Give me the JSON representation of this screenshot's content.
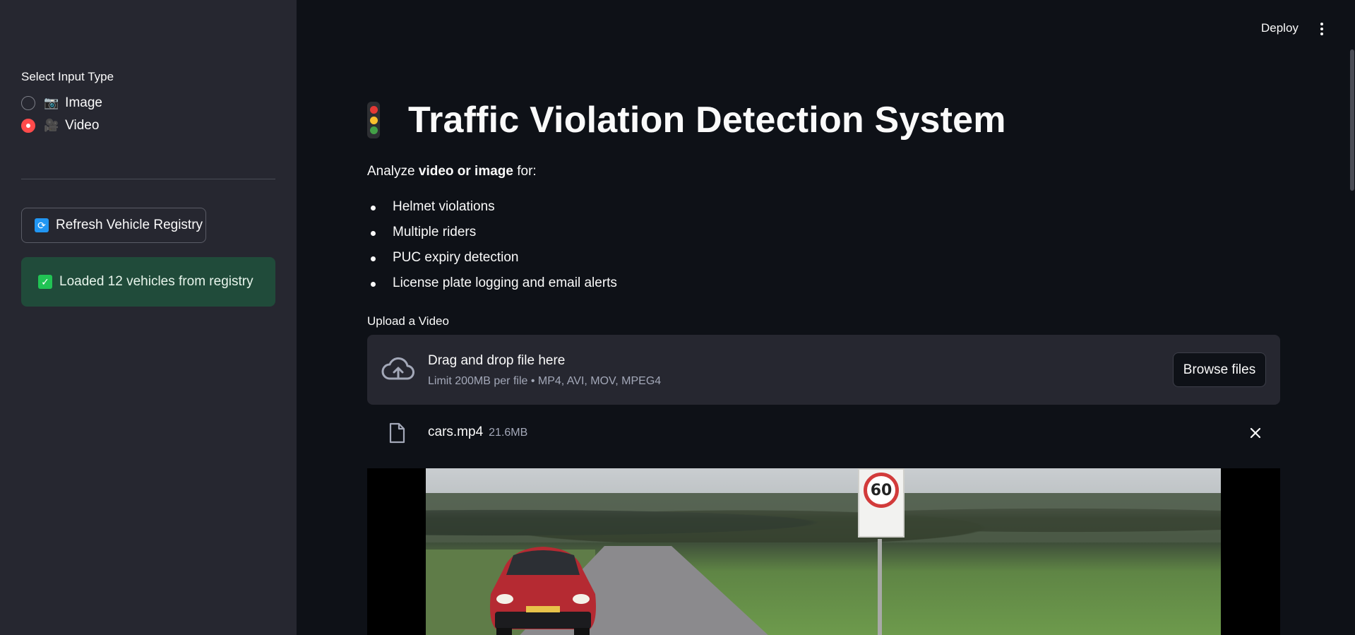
{
  "sidebar": {
    "input_type_label": "Select Input Type",
    "radio_options": [
      {
        "emoji": "📷",
        "label": "Image",
        "checked": false
      },
      {
        "emoji": "🎥",
        "label": "Video",
        "checked": true
      }
    ],
    "refresh_button_label": "Refresh Vehicle Registry",
    "success_message": "Loaded 12 vehicles from registry"
  },
  "header": {
    "deploy_label": "Deploy"
  },
  "main": {
    "title": "Traffic Violation Detection System",
    "intro_prefix": "Analyze ",
    "intro_bold": "video or image",
    "intro_suffix": " for:",
    "features": [
      "Helmet violations",
      "Multiple riders",
      "PUC expiry detection",
      "License plate logging and email alerts"
    ],
    "upload_label": "Upload a Video",
    "dropzone": {
      "title": "Drag and drop file here",
      "subtitle": "Limit 200MB per file • MP4, AVI, MOV, MPEG4",
      "browse_label": "Browse files"
    },
    "file": {
      "name": "cars.mp4",
      "size": "21.6MB"
    },
    "video_frame": {
      "sign_text": "60"
    }
  },
  "colors": {
    "accent": "#ff4b4b",
    "success_bg": "#204b3a",
    "sidebar_bg": "#262730",
    "main_bg": "#0e1117"
  }
}
